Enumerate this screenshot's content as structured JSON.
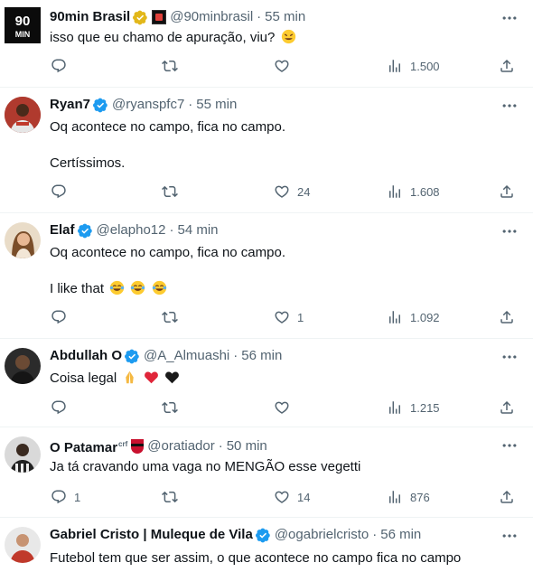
{
  "colors": {
    "text": "#0f1419",
    "muted": "#536471",
    "verified": "#1d9bf0",
    "gold": "#e2b719",
    "divider": "#eff3f4"
  },
  "tweets": [
    {
      "name": "90min Brasil",
      "handle": "@90minbrasil",
      "time": "55 min",
      "avatar_text": "90 MIN",
      "text": [
        "isso que eu chamo de apuração, viu?"
      ],
      "replies": "",
      "retweets": "",
      "likes": "",
      "views": "1.500"
    },
    {
      "name": "Ryan7",
      "handle": "@ryanspfc7",
      "time": "55 min",
      "text": [
        "Oq acontece no campo, fica no campo.",
        "Certíssimos."
      ],
      "replies": "",
      "retweets": "",
      "likes": "24",
      "views": "1.608"
    },
    {
      "name": "Elaf",
      "handle": "@elapho12",
      "time": "54 min",
      "text": [
        "Oq acontece no campo, fica no campo.",
        "I like that"
      ],
      "replies": "",
      "retweets": "",
      "likes": "1",
      "views": "1.092"
    },
    {
      "name": "Abdullah O",
      "handle": "@A_Almuashi",
      "time": "56 min",
      "text": [
        "Coisa legal"
      ],
      "replies": "",
      "retweets": "",
      "likes": "",
      "views": "1.215"
    },
    {
      "name": "O Patamar",
      "name_sup": "crf",
      "handle": "@oratiador",
      "time": "50 min",
      "text": [
        "Ja tá cravando uma vaga no MENGÃO esse vegetti"
      ],
      "replies": "1",
      "retweets": "",
      "likes": "14",
      "views": "876"
    },
    {
      "name": "Gabriel Cristo | Muleque de Vila",
      "handle": "@ogabrielcristo",
      "time": "56 min",
      "text": [
        "Futebol tem que ser assim, o que acontece no campo fica no campo"
      ]
    }
  ],
  "icons": {
    "reply": "reply-icon",
    "retweet": "retweet-icon",
    "like": "heart-icon",
    "views": "views-icon",
    "share": "share-icon",
    "more": "more-icon",
    "verified": "verified-badge-icon"
  }
}
